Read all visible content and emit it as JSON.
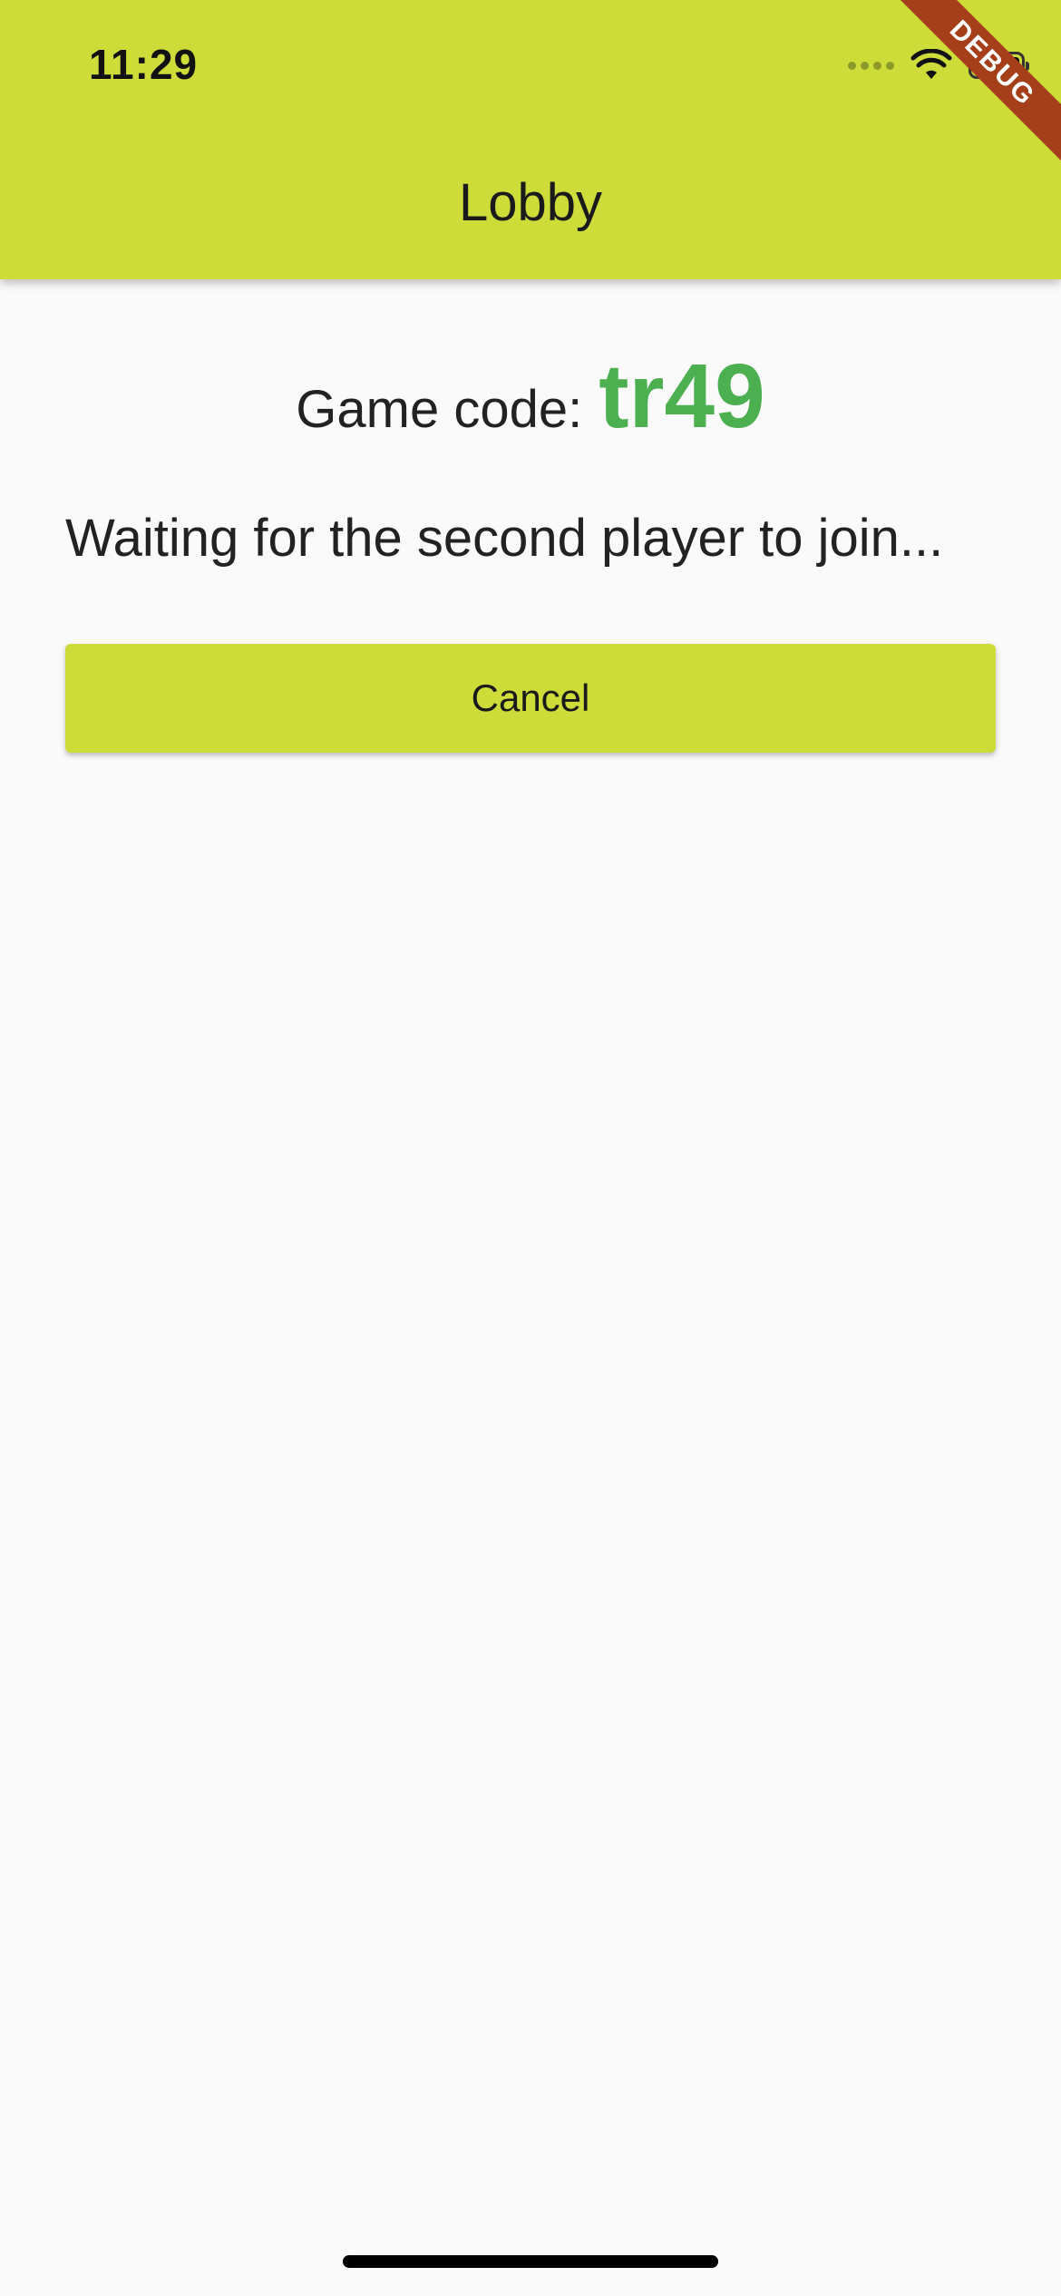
{
  "status_bar": {
    "time": "11:29",
    "icons": [
      "cellular-signal-icon",
      "wifi-icon",
      "battery-icon"
    ]
  },
  "debug_banner": {
    "label": "DEBUG"
  },
  "app_bar": {
    "title": "Lobby"
  },
  "lobby": {
    "code_label": "Game code:",
    "code_value": "tr49",
    "waiting_message": "Waiting for the second player to join...",
    "cancel_label": "Cancel"
  },
  "colors": {
    "accent": "#cddc39",
    "code": "#4caf50",
    "background": "#fafafa",
    "debug": "#a53f1a"
  }
}
